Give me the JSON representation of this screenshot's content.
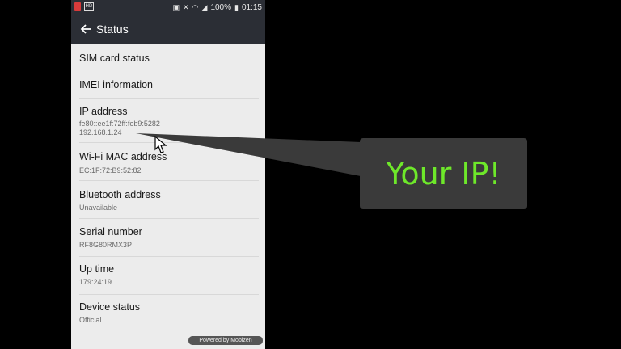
{
  "statusbar": {
    "battery": "100%",
    "time": "01:15"
  },
  "appbar": {
    "title": "Status"
  },
  "items": [
    {
      "title": "SIM card status",
      "subtitle": ""
    },
    {
      "title": "IMEI information",
      "subtitle": ""
    },
    {
      "title": "IP address",
      "subtitle": "fe80::ee1f:72ff:feb9:5282",
      "subtitle2": "192.168.1.24"
    },
    {
      "title": "Wi-Fi MAC address",
      "subtitle": "EC:1F:72:B9:52:82"
    },
    {
      "title": "Bluetooth address",
      "subtitle": "Unavailable"
    },
    {
      "title": "Serial number",
      "subtitle": "RF8G80RMX3P"
    },
    {
      "title": "Up time",
      "subtitle": "179:24:19"
    },
    {
      "title": "Device status",
      "subtitle": "Official"
    }
  ],
  "watermark": "Powered by Mobizen",
  "callout": {
    "text": "Your IP!"
  },
  "colors": {
    "appbar": "#2b2e35",
    "callout_bg": "#3a3a3a",
    "callout_text": "#6ee82a"
  }
}
